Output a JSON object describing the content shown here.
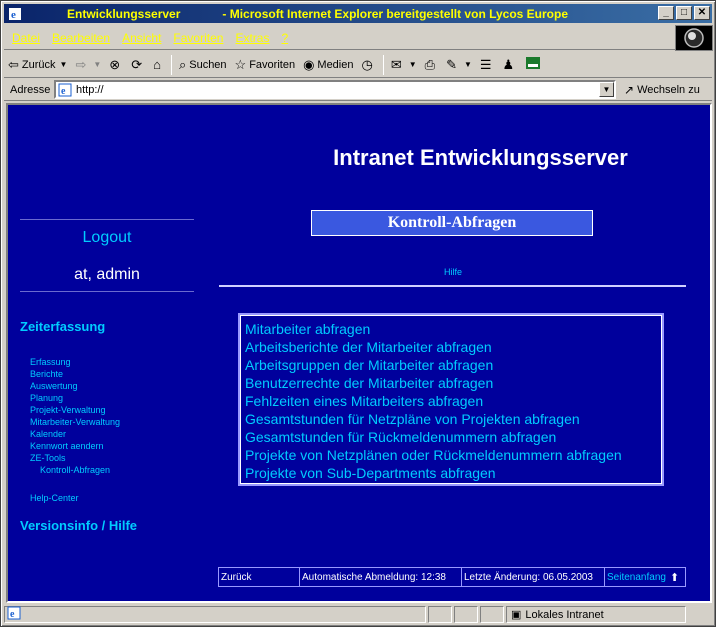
{
  "window": {
    "title_app": "Entwicklungsserver",
    "title_suffix": "- Microsoft Internet Explorer bereitgestellt von Lycos Europe",
    "controls": [
      "_",
      "□",
      "✕"
    ]
  },
  "menubar": [
    "Datei",
    "Bearbeiten",
    "Ansicht",
    "Favoriten",
    "Extras",
    "?"
  ],
  "toolbar": {
    "back": "Zurück",
    "search": "Suchen",
    "favorites": "Favoriten",
    "media": "Medien"
  },
  "addressbar": {
    "label": "Adresse",
    "url": "http://",
    "go": "Wechseln zu"
  },
  "page": {
    "title": "Intranet Entwicklungsserver",
    "logout": "Logout",
    "user": "at, admin",
    "section_zeit": "Zeiterfassung",
    "nav": [
      "Erfassung",
      "Berichte",
      "Auswertung",
      "Planung",
      "Projekt-Verwaltung",
      "Mitarbeiter-Verwaltung",
      "Kalender",
      "Kennwort aendern",
      "ZE-Tools"
    ],
    "nav_sub": "Kontroll-Abfragen",
    "help_center": "Help-Center",
    "section_version": "Versionsinfo / Hilfe",
    "heading": "Kontroll-Abfragen",
    "hilfe": "Hilfe",
    "queries": [
      "Mitarbeiter abfragen",
      "Arbeitsberichte der Mitarbeiter abfragen",
      "Arbeitsgruppen der Mitarbeiter abfragen",
      "Benutzerrechte der Mitarbeiter abfragen",
      "Fehlzeiten eines Mitarbeiters abfragen",
      "Gesamtstunden für Netzpläne von Projekten abfragen",
      "Gesamtstunden für Rückmeldenummern abfragen",
      "Projekte von Netzplänen oder Rückmeldenummern abfragen",
      "Projekte von Sub-Departments abfragen"
    ],
    "footer": {
      "back": "Zurück",
      "auto_logout": "Automatische Abmeldung: 12:38",
      "last_change": "Letzte Änderung: 06.05.2003",
      "top": "Seitenanfang"
    }
  },
  "statusbar": {
    "zone": "Lokales Intranet"
  },
  "colors": {
    "page_bg": "#00009c",
    "link": "#00ccff",
    "heading_box": "#3a58e0",
    "title_text": "#ffff00"
  }
}
